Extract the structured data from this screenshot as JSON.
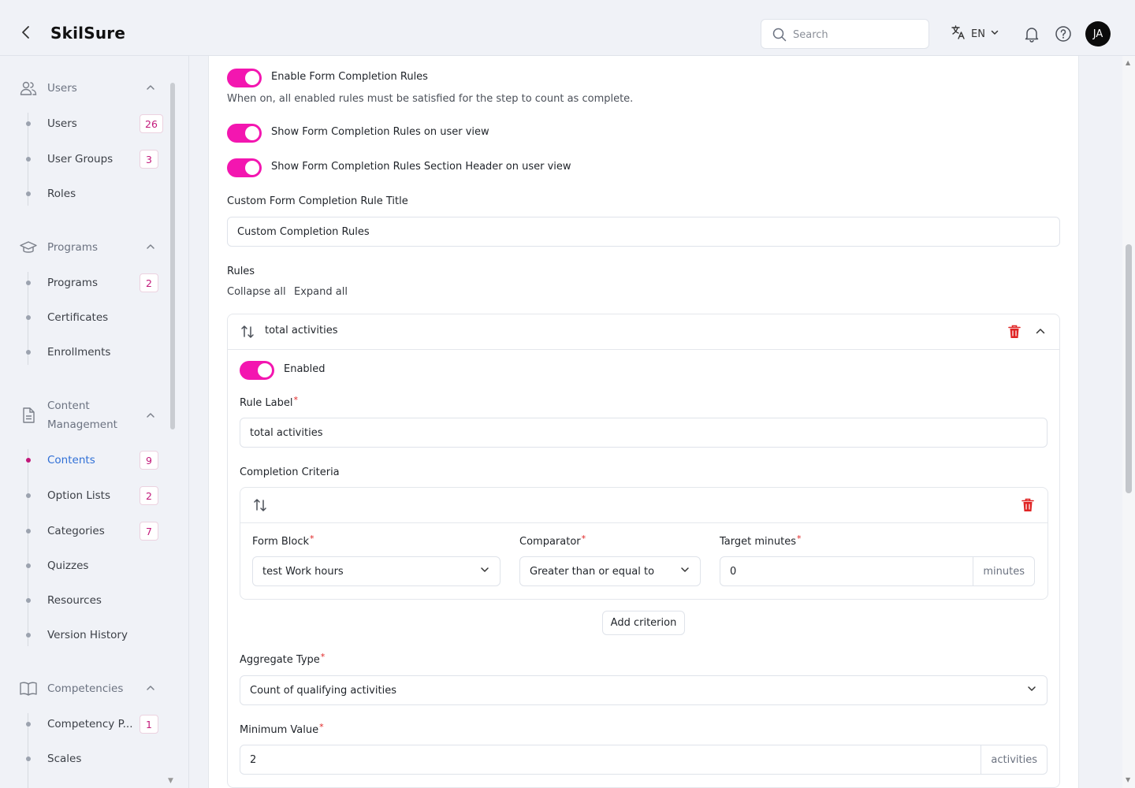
{
  "header": {
    "app_title": "SkilSure",
    "search_placeholder": "Search",
    "language": "EN",
    "avatar_initials": "JA"
  },
  "sidebar": {
    "groups": [
      {
        "label": "Users",
        "icon": "users-icon",
        "items": [
          {
            "label": "Users",
            "count": "26"
          },
          {
            "label": "User Groups",
            "count": "3"
          },
          {
            "label": "Roles",
            "count": ""
          }
        ]
      },
      {
        "label": "Programs",
        "icon": "graduation-cap-icon",
        "items": [
          {
            "label": "Programs",
            "count": "2"
          },
          {
            "label": "Certificates",
            "count": ""
          },
          {
            "label": "Enrollments",
            "count": ""
          }
        ]
      },
      {
        "label_line1": "Content",
        "label_line2": "Management",
        "icon": "document-icon",
        "items": [
          {
            "label": "Contents",
            "count": "9",
            "active": true
          },
          {
            "label": "Option Lists",
            "count": "2"
          },
          {
            "label": "Categories",
            "count": "7"
          },
          {
            "label": "Quizzes",
            "count": ""
          },
          {
            "label": "Resources",
            "count": ""
          },
          {
            "label": "Version History",
            "count": ""
          }
        ]
      },
      {
        "label": "Competencies",
        "icon": "book-icon",
        "items": [
          {
            "label": "Competency P...",
            "count": "1"
          },
          {
            "label": "Scales",
            "count": ""
          }
        ]
      }
    ]
  },
  "form": {
    "enable_rules_label": "Enable Form Completion Rules",
    "enable_rules_help": "When on, all enabled rules must be satisfied for the step to count as complete.",
    "show_rules_label": "Show Form Completion Rules on user view",
    "show_header_label": "Show Form Completion Rules Section Header on user view",
    "custom_title_label": "Custom Form Completion Rule Title",
    "custom_title_value": "Custom Completion Rules",
    "rules_label": "Rules",
    "collapse_all": "Collapse all",
    "expand_all": "Expand all",
    "rule": {
      "title": "total activities",
      "enabled_label": "Enabled",
      "rule_label_label": "Rule Label",
      "rule_label_value": "total activities",
      "criteria_label": "Completion Criteria",
      "criterion": {
        "form_block_label": "Form Block",
        "form_block_value": "test Work hours",
        "comparator_label": "Comparator",
        "comparator_value": "Greater than or equal to",
        "target_label": "Target minutes",
        "target_value": "0",
        "target_suffix": "minutes"
      },
      "add_criterion": "Add criterion",
      "aggregate_type_label": "Aggregate Type",
      "aggregate_type_value": "Count of qualifying activities",
      "minimum_value_label": "Minimum Value",
      "minimum_value_value": "2",
      "minimum_value_suffix": "activities"
    }
  },
  "colors": {
    "accent_pink": "#f316b0",
    "delete_red": "#e02424",
    "active_link_blue": "#2f6fd6"
  }
}
